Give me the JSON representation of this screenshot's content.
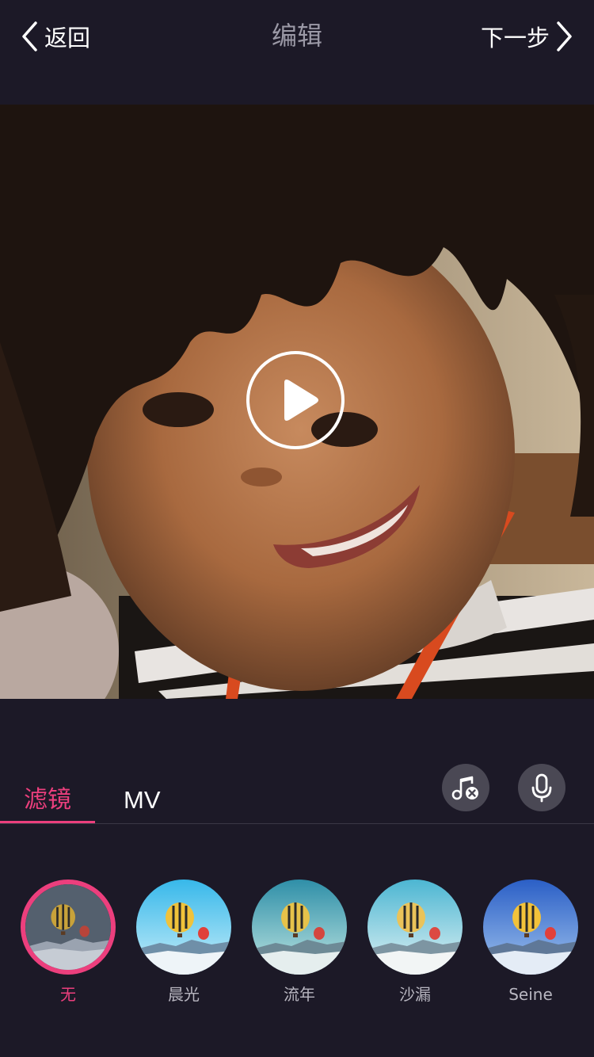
{
  "nav": {
    "back_label": "返回",
    "title": "编辑",
    "next_label": "下一步"
  },
  "tabs": [
    {
      "label": "滤镜",
      "active": true
    },
    {
      "label": "MV",
      "active": false
    }
  ],
  "tools": {
    "music_icon": "music-remove-icon",
    "mic_icon": "microphone-icon"
  },
  "filters": [
    {
      "label": "无",
      "selected": true
    },
    {
      "label": "晨光",
      "selected": false
    },
    {
      "label": "流年",
      "selected": false
    },
    {
      "label": "沙漏",
      "selected": false
    },
    {
      "label": "Seine",
      "selected": false
    }
  ],
  "colors": {
    "background": "#1c1927",
    "accent": "#ec3f7d"
  }
}
